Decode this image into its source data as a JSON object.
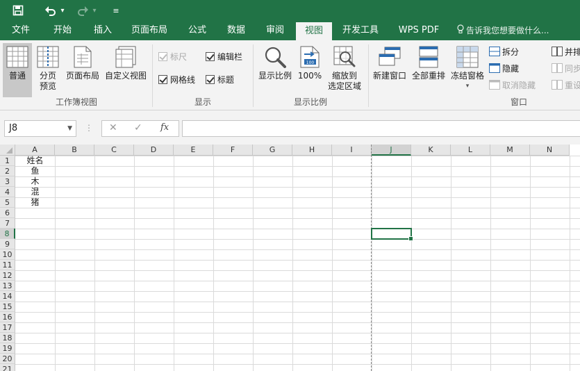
{
  "quick_access": {
    "save_icon": "save-icon",
    "undo_icon": "undo-icon",
    "redo_icon": "redo-icon",
    "customize_icon": "customize-icon",
    "dropdown_glyph": "▾",
    "customize_glyph": "≡"
  },
  "tabs": [
    {
      "label": "文件",
      "active": false
    },
    {
      "label": "开始",
      "active": false
    },
    {
      "label": "插入",
      "active": false
    },
    {
      "label": "页面布局",
      "active": false
    },
    {
      "label": "公式",
      "active": false
    },
    {
      "label": "数据",
      "active": false
    },
    {
      "label": "审阅",
      "active": false
    },
    {
      "label": "视图",
      "active": true
    },
    {
      "label": "开发工具",
      "active": false
    },
    {
      "label": "WPS PDF",
      "active": false
    }
  ],
  "tell_me": "告诉我您想要做什么...",
  "ribbon": {
    "workbook_views": {
      "group_label": "工作簿视图",
      "normal": "普通",
      "page_break_preview_line1": "分页",
      "page_break_preview_line2": "预览",
      "page_layout": "页面布局",
      "custom_views": "自定义视图"
    },
    "show": {
      "group_label": "显示",
      "ruler": {
        "label": "标尺",
        "checked": true,
        "disabled": true
      },
      "formula_bar": {
        "label": "编辑栏",
        "checked": true,
        "disabled": false
      },
      "gridlines": {
        "label": "网格线",
        "checked": true,
        "disabled": false
      },
      "headings": {
        "label": "标题",
        "checked": true,
        "disabled": false
      }
    },
    "zoom": {
      "group_label": "显示比例",
      "zoom": "显示比例",
      "zoom_100": "100%",
      "zoom_selection_line1": "缩放到",
      "zoom_selection_line2": "选定区域"
    },
    "window": {
      "group_label": "窗口",
      "new_window": "新建窗口",
      "arrange_all": "全部重排",
      "freeze_panes": "冻结窗格",
      "freeze_dropdown": "▾",
      "split": "拆分",
      "hide": "隐藏",
      "unhide": "取消隐藏",
      "side_by_side": "并排",
      "sync_scroll": "同步",
      "reset_position": "重设"
    }
  },
  "formula_bar": {
    "name_box": "J8",
    "name_dropdown": "▼",
    "dots": "⋮",
    "cancel": "✕",
    "enter": "✓",
    "fx": "fx",
    "value": ""
  },
  "sheet": {
    "columns": [
      "A",
      "B",
      "C",
      "D",
      "E",
      "F",
      "G",
      "H",
      "I",
      "J",
      "K",
      "L",
      "M",
      "N"
    ],
    "rows": [
      "1",
      "2",
      "3",
      "4",
      "5",
      "6",
      "7",
      "8",
      "9",
      "10",
      "11",
      "12",
      "13",
      "14",
      "15",
      "16",
      "17",
      "18",
      "19",
      "20",
      "21"
    ],
    "selected_cell": "J8",
    "column_a": [
      "姓名",
      "鱼",
      "木",
      "混",
      "猪"
    ]
  },
  "colors": {
    "accent": "#217346",
    "ribbon_bg": "#f3f3f3",
    "header_bg": "#e6e6e6"
  }
}
